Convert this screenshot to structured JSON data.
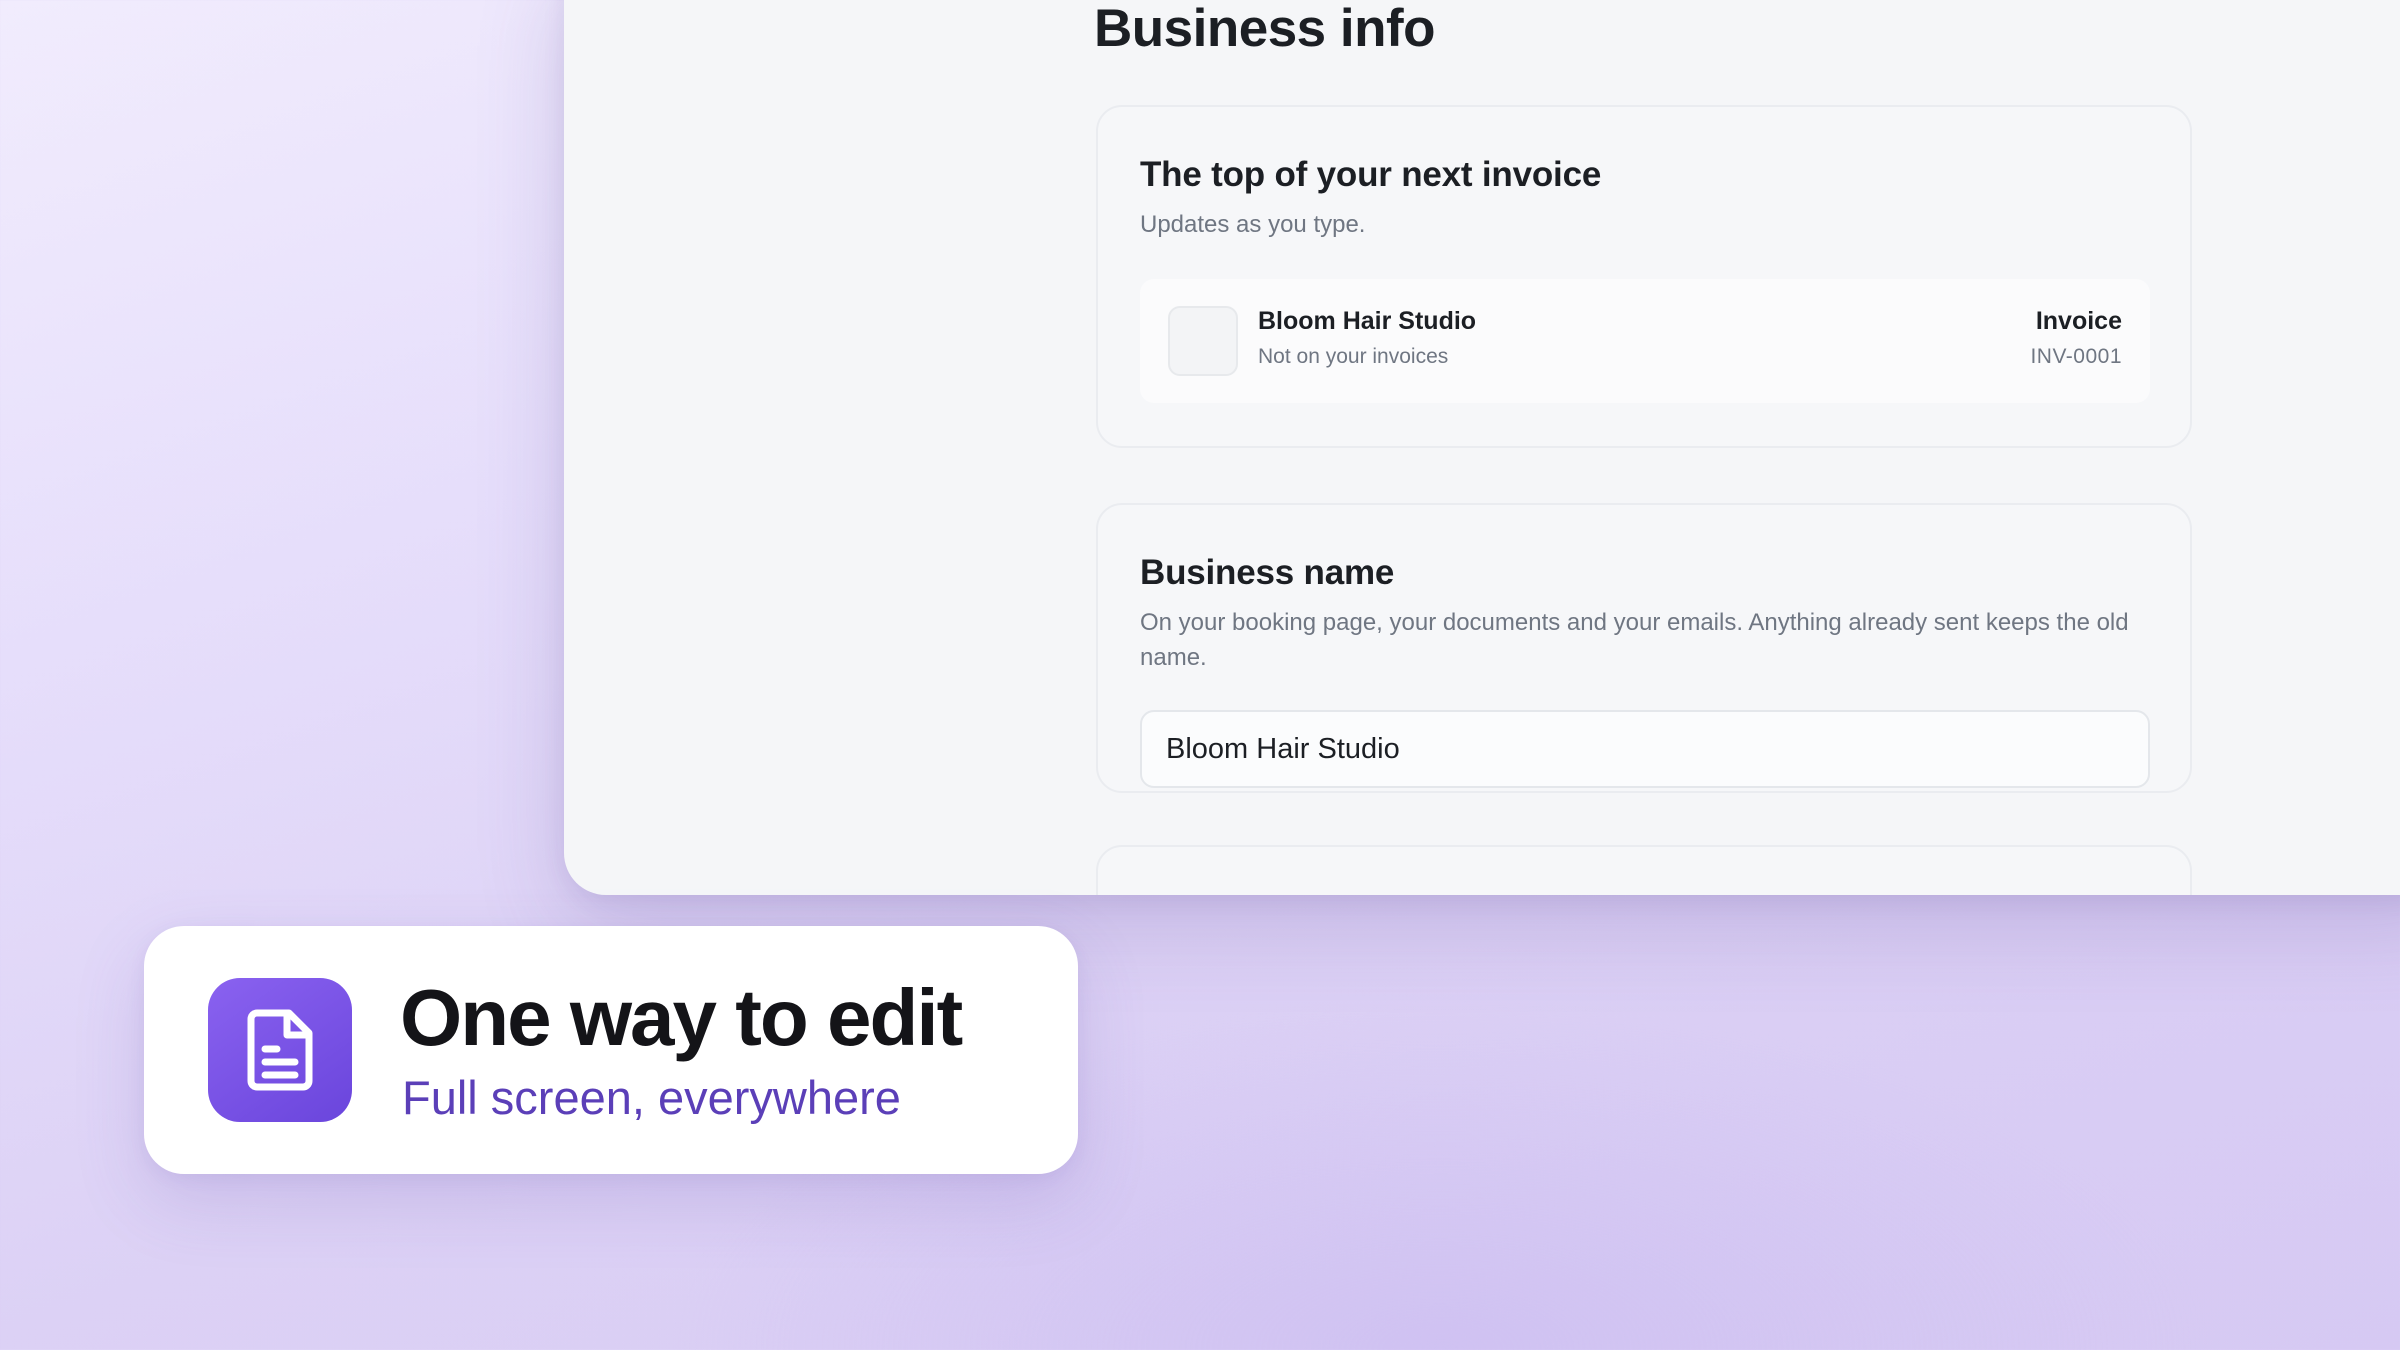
{
  "page": {
    "title": "Business info"
  },
  "invoice_card": {
    "title": "The top of your next invoice",
    "subtitle": "Updates as you type.",
    "preview": {
      "business_name": "Bloom Hair Studio",
      "business_note": "Not on your invoices",
      "document_label": "Invoice",
      "document_number": "INV-0001"
    }
  },
  "name_card": {
    "title": "Business name",
    "description": "On your booking page, your documents and your emails. Anything already sent keeps the old name.",
    "input_value": "Bloom Hair Studio"
  },
  "caption": {
    "icon": "document-icon",
    "title": "One way to edit",
    "subtitle": "Full screen, everywhere"
  },
  "colors": {
    "accent": "#6a45dc",
    "accent_text": "#5b3fb8",
    "background": "#dcd1f5"
  }
}
